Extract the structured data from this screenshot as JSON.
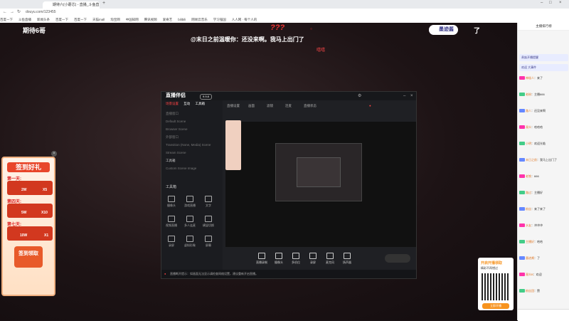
{
  "browser": {
    "tabs": [
      {
        "label": "期待六(小蘑芯) - 直播_斗鱼直播(TV)"
      },
      {
        "label": ""
      }
    ],
    "url": "douyu.com/123455",
    "bookmarks": [
      "百度一下",
      "斗鱼直播",
      "新闻头条",
      "百度一下",
      "百度一下",
      "天猫mall",
      "淘宝网",
      "中国知网",
      "腾讯视频",
      "爱奇艺",
      "bilibili",
      "网易云音乐",
      "学习强国",
      "人人网 · 每个人的"
    ]
  },
  "stream": {
    "streamer_title": "期待6哥",
    "chat_overlay": "@末日之前温暖你：还没来啊。我马上出门了",
    "question_marks": "???",
    "red_mark": "○",
    "haha": "嘻嘻",
    "badge_name": "墨迹酱",
    "le": "了"
  },
  "app": {
    "title": "直播伴侣",
    "version": "9.9.8",
    "side_tabs": [
      "场景设置",
      "互动",
      "工具箱"
    ],
    "side_items": [
      "直播窗口",
      "Default Scene",
      "Browser Scene",
      "外部窗口",
      "Transition (None, Media) Scene",
      "Stream Scene",
      "工具箱",
      "Custom Scene Image"
    ],
    "toolbox_label": "工具箱",
    "tools": [
      "摄像头",
      "游戏直播",
      "文字",
      "视频直播",
      "多人连麦",
      "横竖切换",
      "录屏",
      "虚拟形象",
      "屏幕"
    ],
    "top_toolbar": [
      "直播设置",
      "画面",
      "滤镜",
      "连麦",
      "直播状态"
    ],
    "bottom_tools": [
      "直播录制",
      "摄像头",
      "多机位",
      "录屏",
      "麦克风",
      "扬声器"
    ],
    "status_text": "直播断开提示：如画面无法显示请检查网络设置，建议重新开启直播。"
  },
  "signin": {
    "title": "签到好礼",
    "days": [
      "第一天:",
      "第四天:",
      "第七天:"
    ],
    "rewards": [
      {
        "left": "2W",
        "right": "X5"
      },
      {
        "left": "5W",
        "right": "X10"
      },
      {
        "left": "10W",
        "right": "X1"
      }
    ],
    "button": "签到领取"
  },
  "qr": {
    "title": "开启开播领取",
    "subtitle": "精彩不再错过",
    "button": "立即开播"
  },
  "chatpanel": {
    "header": "主播排行榜",
    "notices": [
      "贵族开播提醒",
      "欢迎 大事件"
    ],
    "messages": [
      {
        "user": "神秘人",
        "text": "来了"
      },
      {
        "user": "老粉",
        "text": "主播666"
      },
      {
        "user": "路人",
        "text": "还没来啊"
      },
      {
        "user": "观众",
        "text": "哈哈哈"
      },
      {
        "user": "小明",
        "text": "欢迎光临"
      },
      {
        "user": "末日之前",
        "text": "我马上出门了"
      },
      {
        "user": "老铁",
        "text": "666"
      },
      {
        "user": "路过",
        "text": "主播好"
      },
      {
        "user": "粉丝",
        "text": "来了来了"
      },
      {
        "user": "水友",
        "text": "冲冲冲"
      },
      {
        "user": "主播好",
        "text": "哈哈"
      },
      {
        "user": "墨迹酱",
        "text": "了"
      },
      {
        "user": "观众B",
        "text": "欢迎"
      },
      {
        "user": "粉丝团",
        "text": "赞"
      }
    ]
  }
}
